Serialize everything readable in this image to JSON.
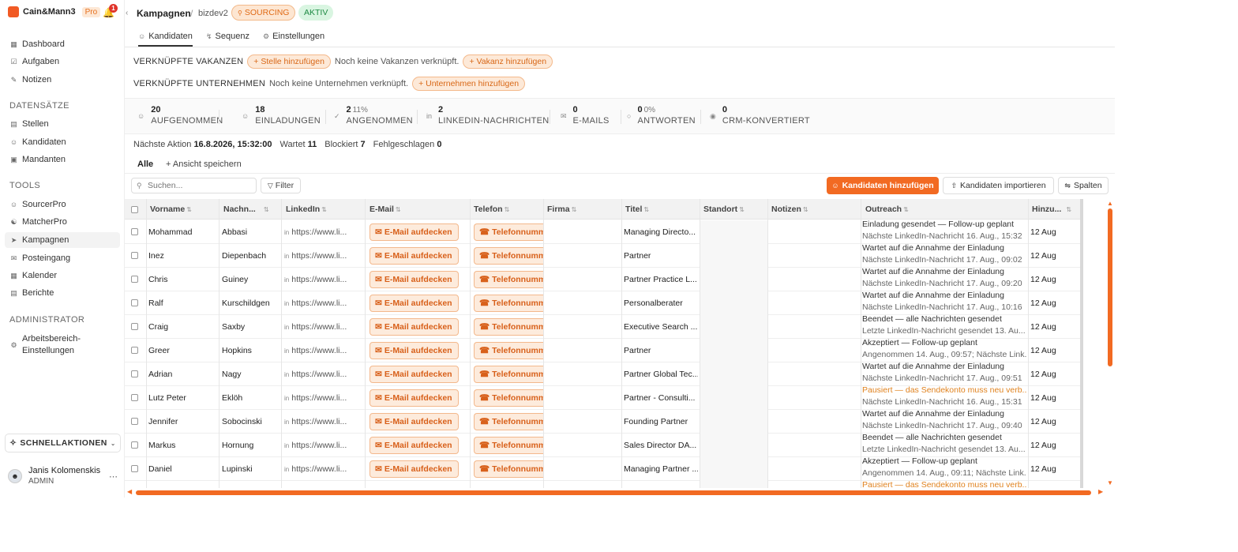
{
  "app": {
    "name": "Cain&Mann3",
    "plan": "Pro",
    "notification_count": "1"
  },
  "sidebar": {
    "top_items": [
      {
        "label": "Dashboard",
        "icon": "grid-icon"
      },
      {
        "label": "Aufgaben",
        "icon": "checkbox-icon"
      },
      {
        "label": "Notizen",
        "icon": "note-icon"
      }
    ],
    "sections": [
      {
        "title": "DATENSÄTZE",
        "items": [
          {
            "label": "Stellen",
            "icon": "building-icon"
          },
          {
            "label": "Kandidaten",
            "icon": "users-icon"
          },
          {
            "label": "Mandanten",
            "icon": "briefcase-icon"
          }
        ]
      },
      {
        "title": "TOOLS",
        "items": [
          {
            "label": "SourcerPro",
            "icon": "users-search-icon"
          },
          {
            "label": "MatcherPro",
            "icon": "match-icon"
          },
          {
            "label": "Kampagnen",
            "icon": "rocket-icon"
          },
          {
            "label": "Posteingang",
            "icon": "inbox-icon"
          },
          {
            "label": "Kalender",
            "icon": "calendar-icon"
          },
          {
            "label": "Berichte",
            "icon": "report-icon"
          }
        ]
      },
      {
        "title": "ADMINISTRATOR",
        "items": [
          {
            "label": "Arbeitsbereich-",
            "label2": "Einstellungen",
            "icon": "gear-icon"
          }
        ]
      }
    ],
    "quick_actions": "SCHNELLAKTIONEN",
    "user": {
      "name": "Janis Kolomenskis",
      "role": "ADMIN"
    }
  },
  "header": {
    "title": "Kampagnen",
    "separator": "/",
    "sub": "bizdev2",
    "tag_sourcing": "SOURCING",
    "tag_active": "AKTIV"
  },
  "tabs": [
    {
      "label": "Kandidaten",
      "icon": "users-icon"
    },
    {
      "label": "Sequenz",
      "icon": "sequence-icon"
    },
    {
      "label": "Einstellungen",
      "icon": "gear-icon"
    }
  ],
  "linked": {
    "vacancies_label": "VERKNÜPFTE VAKANZEN",
    "add_position": "+ Stelle hinzufügen",
    "vacancies_empty": "Noch keine Vakanzen verknüpft.",
    "add_vacancy": "+ Vakanz hinzufügen",
    "companies_label": "VERKNÜPFTE UNTERNEHMEN",
    "companies_empty": "Noch keine Unternehmen verknüpft.",
    "add_company": "+ Unternehmen hinzufügen"
  },
  "stats": [
    {
      "value": "20",
      "pct": "",
      "label": "AUFGENOMMEN"
    },
    {
      "value": "18",
      "pct": "",
      "label": "EINLADUNGEN"
    },
    {
      "value": "2",
      "pct": "11%",
      "label": "ANGENOMMEN"
    },
    {
      "value": "2",
      "pct": "",
      "label": "LINKEDIN-NACHRICHTEN"
    },
    {
      "value": "0",
      "pct": "",
      "label": "E-MAILS"
    },
    {
      "value": "0",
      "pct": "0%",
      "label": "ANTWORTEN"
    },
    {
      "value": "0",
      "pct": "",
      "label": "CRM-KONVERTIERT"
    }
  ],
  "next_action": {
    "label": "Nächste Aktion",
    "value": "16.8.2026, 15:32:00",
    "waiting_label": "Wartet",
    "waiting": "11",
    "blocked_label": "Blockiert",
    "blocked": "7",
    "failed_label": "Fehlgeschlagen",
    "failed": "0"
  },
  "views": {
    "all": "Alle",
    "save": "+ Ansicht speichern"
  },
  "toolbar": {
    "search_placeholder": "Suchen...",
    "filter": "Filter",
    "add_candidates": "Kandidaten hinzufügen",
    "import_candidates": "Kandidaten importieren",
    "columns": "Spalten"
  },
  "table": {
    "headers": [
      "Vorname",
      "Nachn...",
      "LinkedIn",
      "E-Mail",
      "Telefon",
      "Firma",
      "Titel",
      "Standort",
      "Notizen",
      "Outreach",
      "Hinzu..."
    ],
    "email_action": "E-Mail aufdecken",
    "phone_action": "Telefonnummer",
    "rows": [
      {
        "first": "Mohammad",
        "last": "Abbasi",
        "linkedin": "https://www.li...",
        "title": "Managing Directo...",
        "o1": "Einladung gesendet — Follow-up geplant",
        "o2": "Nächste LinkedIn-Nachricht 16. Aug., 15:32",
        "warn": false,
        "added": "12 Aug"
      },
      {
        "first": "Inez",
        "last": "Diepenbach",
        "linkedin": "https://www.li...",
        "title": "Partner",
        "o1": "Wartet auf die Annahme der Einladung",
        "o2": "Nächste LinkedIn-Nachricht 17. Aug., 09:02",
        "warn": false,
        "added": "12 Aug"
      },
      {
        "first": "Chris",
        "last": "Guiney",
        "linkedin": "https://www.li...",
        "title": "Partner Practice L...",
        "o1": "Wartet auf die Annahme der Einladung",
        "o2": "Nächste LinkedIn-Nachricht 17. Aug., 09:20",
        "warn": false,
        "added": "12 Aug"
      },
      {
        "first": "Ralf",
        "last": "Kurschildgen",
        "linkedin": "https://www.li...",
        "title": "Personalberater",
        "o1": "Wartet auf die Annahme der Einladung",
        "o2": "Nächste LinkedIn-Nachricht 17. Aug., 10:16",
        "warn": false,
        "added": "12 Aug"
      },
      {
        "first": "Craig",
        "last": "Saxby",
        "linkedin": "https://www.li...",
        "title": "Executive Search ...",
        "o1": "Beendet — alle Nachrichten gesendet",
        "o2": "Letzte LinkedIn-Nachricht gesendet 13. Au...",
        "warn": false,
        "added": "12 Aug"
      },
      {
        "first": "Greer",
        "last": "Hopkins",
        "linkedin": "https://www.li...",
        "title": "Partner",
        "o1": "Akzeptiert — Follow-up geplant",
        "o2": "Angenommen 14. Aug., 09:57; Nächste Link...",
        "warn": false,
        "added": "12 Aug"
      },
      {
        "first": "Adrian",
        "last": "Nagy",
        "linkedin": "https://www.li...",
        "title": "Partner Global Tec...",
        "o1": "Wartet auf die Annahme der Einladung",
        "o2": "Nächste LinkedIn-Nachricht 17. Aug., 09:51",
        "warn": false,
        "added": "12 Aug"
      },
      {
        "first": "Lutz Peter",
        "last": "Eklöh",
        "linkedin": "https://www.li...",
        "title": "Partner - Consulti...",
        "o1": "Pausiert — das Sendekonto muss neu verb...",
        "o2": "Nächste LinkedIn-Nachricht 16. Aug., 15:31",
        "warn": true,
        "added": "12 Aug"
      },
      {
        "first": "Jennifer",
        "last": "Sobocinski",
        "linkedin": "https://www.li...",
        "title": "Founding Partner",
        "o1": "Wartet auf die Annahme der Einladung",
        "o2": "Nächste LinkedIn-Nachricht 17. Aug., 09:40",
        "warn": false,
        "added": "12 Aug"
      },
      {
        "first": "Markus",
        "last": "Hornung",
        "linkedin": "https://www.li...",
        "title": "Sales Director DA...",
        "o1": "Beendet — alle Nachrichten gesendet",
        "o2": "Letzte LinkedIn-Nachricht gesendet 13. Au...",
        "warn": false,
        "added": "12 Aug"
      },
      {
        "first": "Daniel",
        "last": "Lupinski",
        "linkedin": "https://www.li...",
        "title": "Managing Partner ...",
        "o1": "Akzeptiert — Follow-up geplant",
        "o2": "Angenommen 14. Aug., 09:11; Nächste Link...",
        "warn": false,
        "added": "12 Aug"
      }
    ],
    "partial_row_outreach": "Pausiert — das Sendekonto muss neu verb..."
  },
  "colors": {
    "accent": "#f26a22",
    "accent_soft": "#fde9d8",
    "success": "#1f8a44"
  }
}
